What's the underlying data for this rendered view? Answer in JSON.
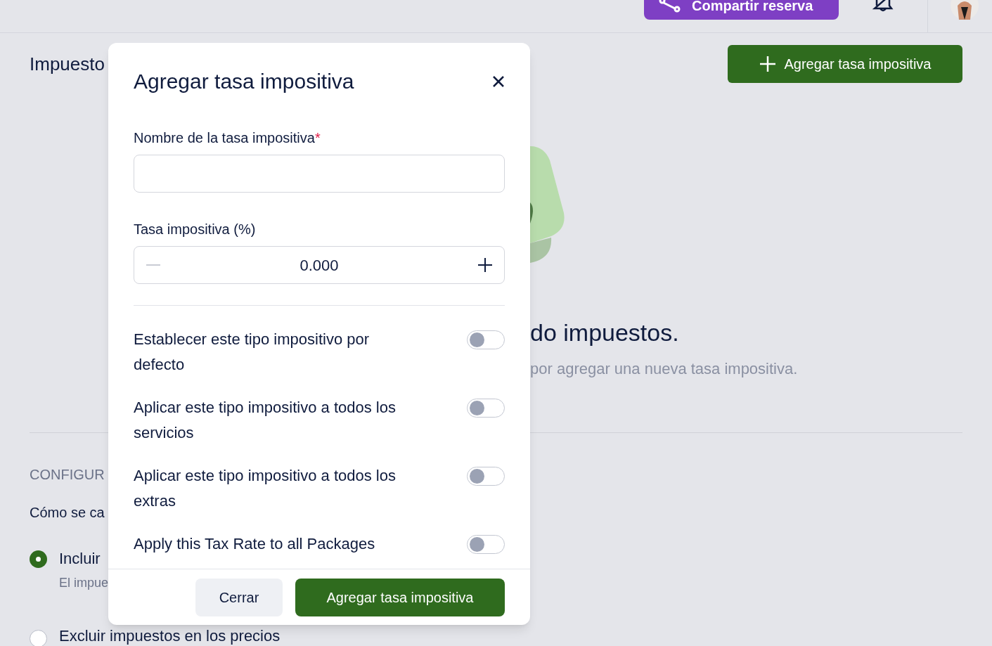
{
  "topbar": {
    "share_button": "Compartir reserva"
  },
  "page": {
    "title": "Impuesto",
    "add_button": "Agregar tasa impositiva",
    "empty_state": {
      "heading": "do impuestos.",
      "text": "por agregar una nueva tasa impositiva."
    },
    "settings": {
      "section_title": "CONFIGUR",
      "question": "Cómo se ca",
      "options": [
        {
          "label": "Incluir",
          "description": "El impue",
          "selected": true
        },
        {
          "label": "Excluir impuestos en los precios",
          "selected": false
        }
      ]
    }
  },
  "dialog": {
    "title": "Agregar tasa impositiva",
    "name_field": {
      "label": "Nombre de la tasa impositiva",
      "required_mark": "*"
    },
    "rate_field": {
      "label": "Tasa impositiva (%)",
      "value": "0.000",
      "minus_disabled": true
    },
    "toggles": [
      {
        "label": "Establecer este tipo impositivo por defecto",
        "on": false
      },
      {
        "label": "Aplicar este tipo impositivo a todos los servicios",
        "on": false
      },
      {
        "label": "Aplicar este tipo impositivo a todos los extras",
        "on": false
      },
      {
        "label": "Apply this Tax Rate to all Packages",
        "on": false
      }
    ],
    "buttons": {
      "cancel": "Cerrar",
      "submit": "Agregar tasa impositiva"
    }
  }
}
